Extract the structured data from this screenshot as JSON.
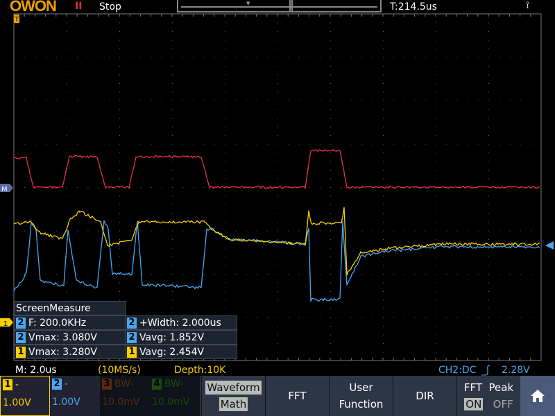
{
  "header": {
    "logo": "OWON",
    "run_icon": "II",
    "run_state": "Stop",
    "trigger_time": "T:214.5us",
    "usb_icon": "usb-icon"
  },
  "markers": {
    "trigger": "T",
    "math": "M",
    "ch1": "1"
  },
  "measure": {
    "title": "ScreenMeasure",
    "items": [
      {
        "ch": "2",
        "text": "F: 200.0KHz"
      },
      {
        "ch": "2",
        "text": "+Width: 2.000us"
      },
      {
        "ch": "2",
        "text": "Vmax: 3.080V"
      },
      {
        "ch": "2",
        "text": "Vavg: 1.852V"
      },
      {
        "ch": "1",
        "text": "Vmax: 3.280V"
      },
      {
        "ch": "1",
        "text": "Vavg: 2.454V"
      }
    ]
  },
  "status": {
    "timebase": "M: 2.0us",
    "sample_rate": "(10MS/s)",
    "depth": "Depth:10K",
    "trigger": "CH2:DC",
    "trigger_level": "2.28V"
  },
  "channels": [
    {
      "num": "1",
      "label": "-",
      "scale": "1.00V",
      "color": "#f8d000"
    },
    {
      "num": "2",
      "label": "-",
      "scale": "1.00V",
      "color": "#4aa8f0"
    },
    {
      "num": "3",
      "label": "BW-",
      "scale": "10.0mV",
      "color": "#5a2a10"
    },
    {
      "num": "4",
      "label": "BW-",
      "scale": "10.0mV",
      "color": "#1a4a10"
    }
  ],
  "menu": {
    "waveform": "Waveform",
    "math": "Math",
    "fft": "FFT",
    "user1": "User",
    "user2": "Function",
    "dir": "DIR",
    "fft_peak": "FFT  Peak",
    "on": "ON",
    "off": "OFF"
  },
  "colors": {
    "ch1": "#f8d000",
    "ch2": "#4aa8f0",
    "math": "#e83050"
  }
}
